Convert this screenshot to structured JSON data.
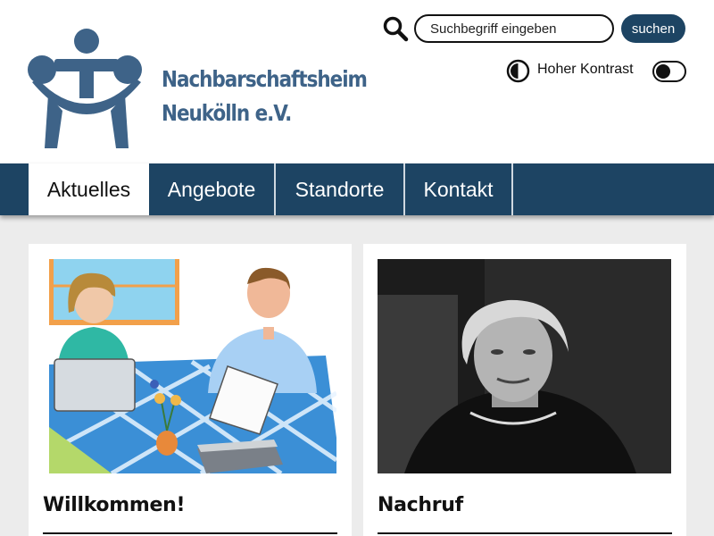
{
  "header": {
    "logo_line1": "Nachbarschaftsheim",
    "logo_line2": "Neukölln e.V.",
    "brand_color": "#3e6388"
  },
  "search": {
    "placeholder": "Suchbegriff eingeben",
    "button_label": "suchen"
  },
  "contrast": {
    "label": "Hoher Kontrast",
    "enabled": false
  },
  "nav": {
    "items": [
      {
        "label": "Aktuelles",
        "active": true
      },
      {
        "label": "Angebote",
        "active": false
      },
      {
        "label": "Standorte",
        "active": false
      },
      {
        "label": "Kontakt",
        "active": false
      }
    ],
    "bar_color": "#1d4463"
  },
  "cards": [
    {
      "title": "Willkommen!"
    },
    {
      "title": "Nachruf"
    }
  ]
}
